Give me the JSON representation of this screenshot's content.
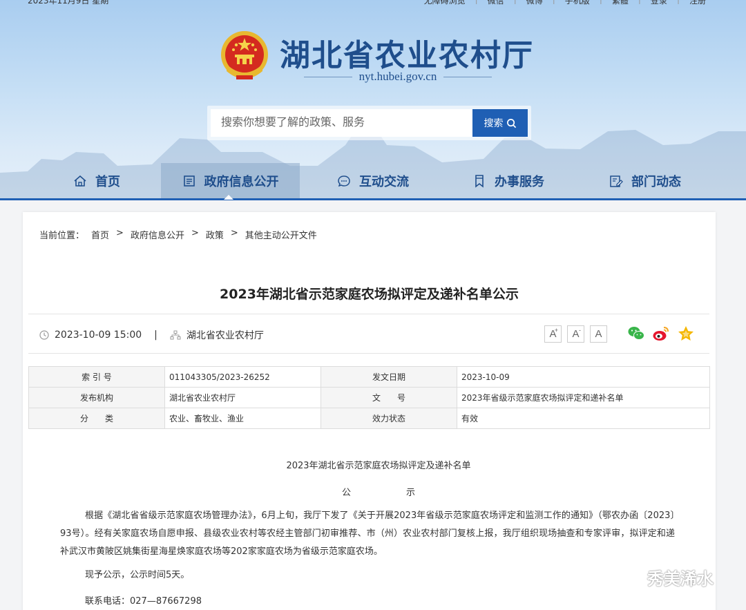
{
  "topbar": {
    "date": "2023年11月9日 星期",
    "links": [
      "无障碍浏览",
      "微信",
      "微博",
      "手机版",
      "繁體",
      "登录",
      "注册"
    ]
  },
  "site": {
    "title": "湖北省农业农村厅",
    "url": "nyt.hubei.gov.cn"
  },
  "search": {
    "placeholder": "搜索你想要了解的政策、服务",
    "button": "搜索"
  },
  "nav": [
    {
      "label": "首页",
      "icon": "home-icon"
    },
    {
      "label": "政府信息公开",
      "icon": "document-icon",
      "active": true
    },
    {
      "label": "互动交流",
      "icon": "chat-icon"
    },
    {
      "label": "办事服务",
      "icon": "bookmark-icon"
    },
    {
      "label": "部门动态",
      "icon": "edit-icon"
    }
  ],
  "breadcrumb": {
    "prefix": "当前位置：",
    "items": [
      "首页",
      "政府信息公开",
      "政策",
      "其他主动公开文件"
    ]
  },
  "article": {
    "title": "2023年湖北省示范家庭农场拟评定及递补名单公示",
    "datetime": "2023-10-09 15:00",
    "source": "湖北省农业农村厅",
    "font_sizes": [
      "A",
      "A",
      "A"
    ]
  },
  "info_table": {
    "index_label": "索 引 号",
    "index_value": "011043305/2023-26252",
    "date_label": "发文日期",
    "date_value": "2023-10-09",
    "org_label": "发布机构",
    "org_value": "湖北省农业农村厅",
    "docno_label": "文　　号",
    "docno_value": "2023年省级示范家庭农场拟评定和递补名单",
    "category_label": "分　　类",
    "category_value": "农业、畜牧业、渔业",
    "status_label": "效力状态",
    "status_value": "有效"
  },
  "body": {
    "doc_title": "2023年湖北省示范家庭农场拟评定及递补名单",
    "doc_sub_a": "公",
    "doc_sub_b": "示",
    "para1": "根据《湖北省省级示范家庭农场管理办法》，6月上旬，我厅下发了《关于开展2023年省级示范家庭农场评定和监测工作的通知》（鄂农办函〔2023〕93号）。经有关家庭农场自愿申报、县级农业农村等农经主管部门初审推荐、市（州）农业农村部门复核上报，我厅组织现场抽查和专家评审，拟评定和递补武汉市黄陂区姚集街星海星焕家庭农场等202家家庭农场为省级示范家庭农场。",
    "para2": "现予公示，公示时间5天。",
    "para3": "联系电话：027—87667298"
  },
  "watermark": "秀美浠水"
}
